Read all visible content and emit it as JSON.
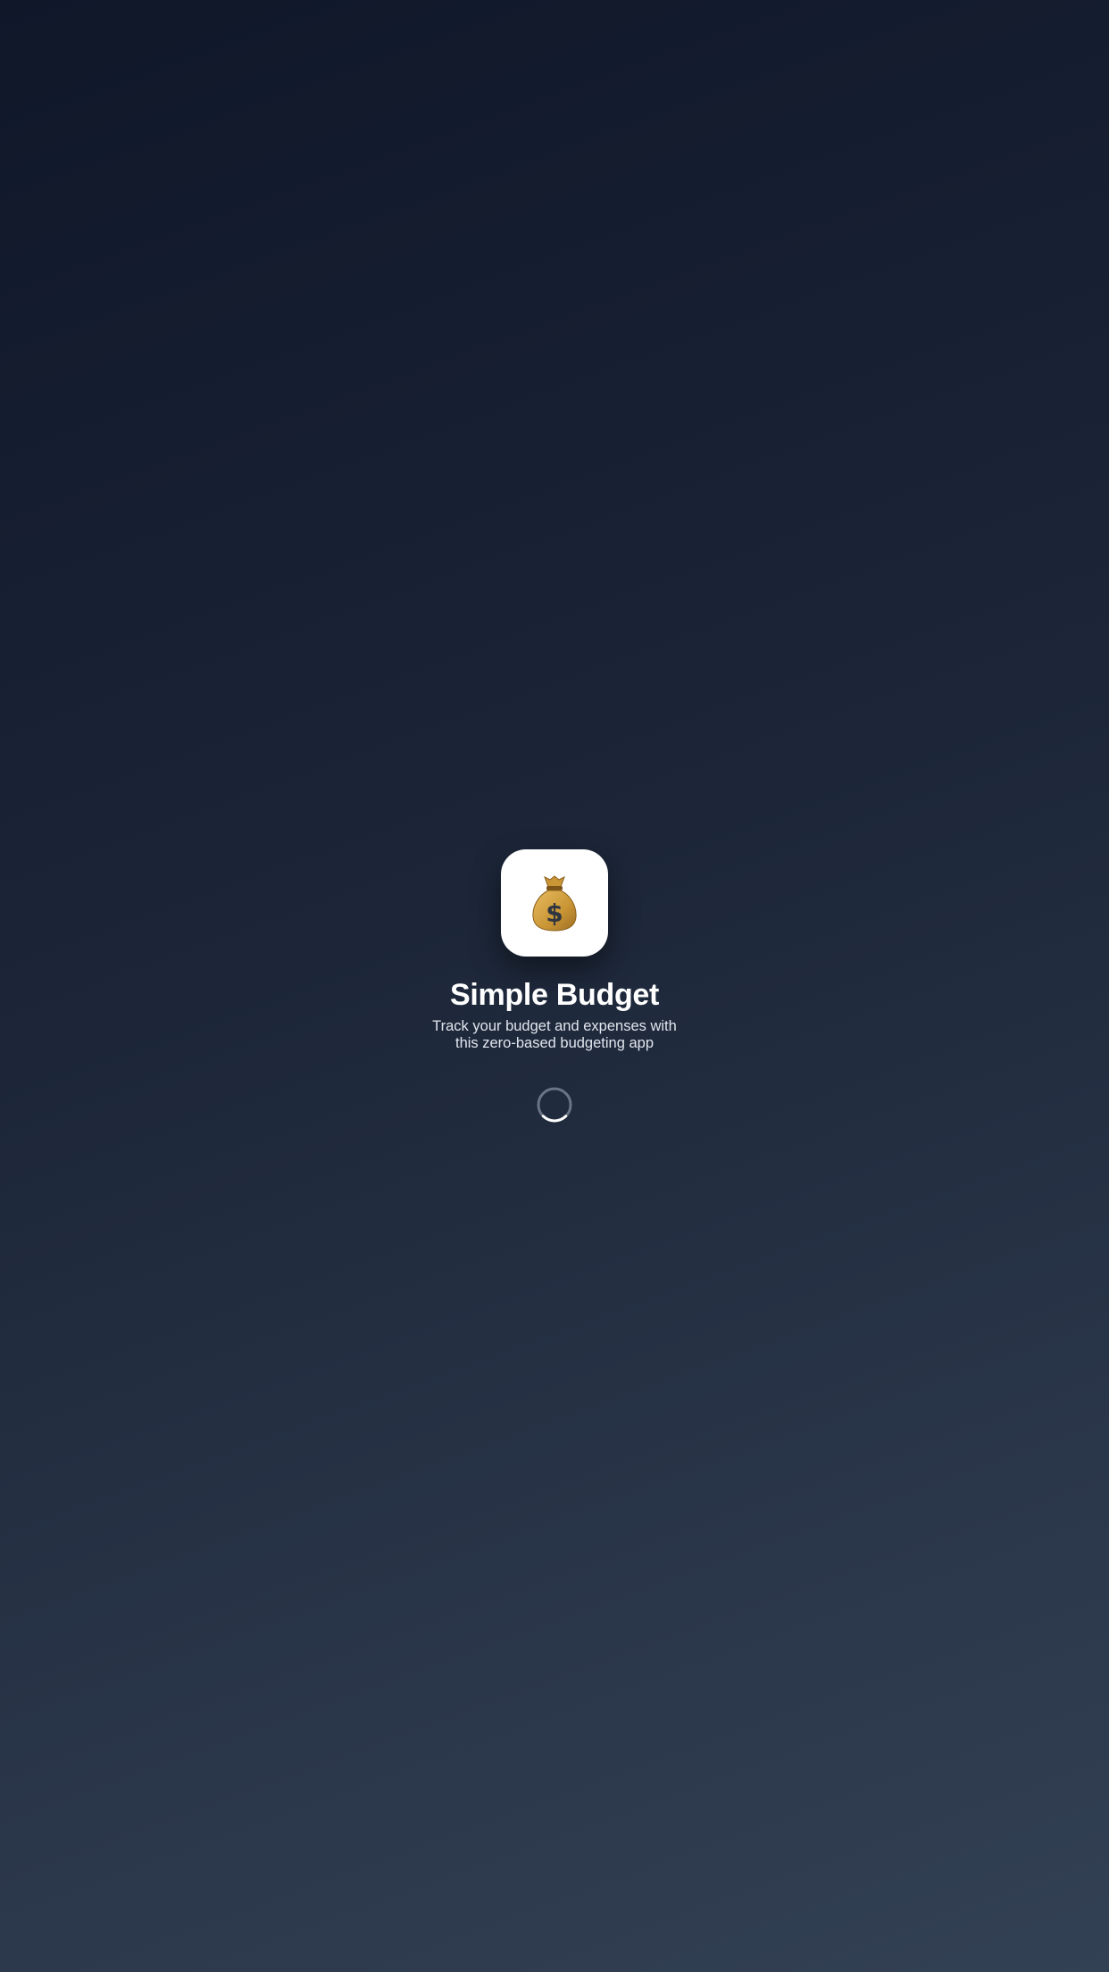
{
  "splash": {
    "icon": "money-bag-icon",
    "title": "Simple Budget",
    "subtitle": "Track your budget and expenses with this zero-based budgeting app",
    "loading_indicator": "spinner"
  },
  "colors": {
    "background_top": "#0f1729",
    "background_bottom": "#334155",
    "icon_tile": "#ffffff",
    "text_primary": "#ffffff",
    "text_secondary": "#e2e6ee",
    "money_bag": "#d9a441",
    "spinner_track": "#6b7484"
  }
}
